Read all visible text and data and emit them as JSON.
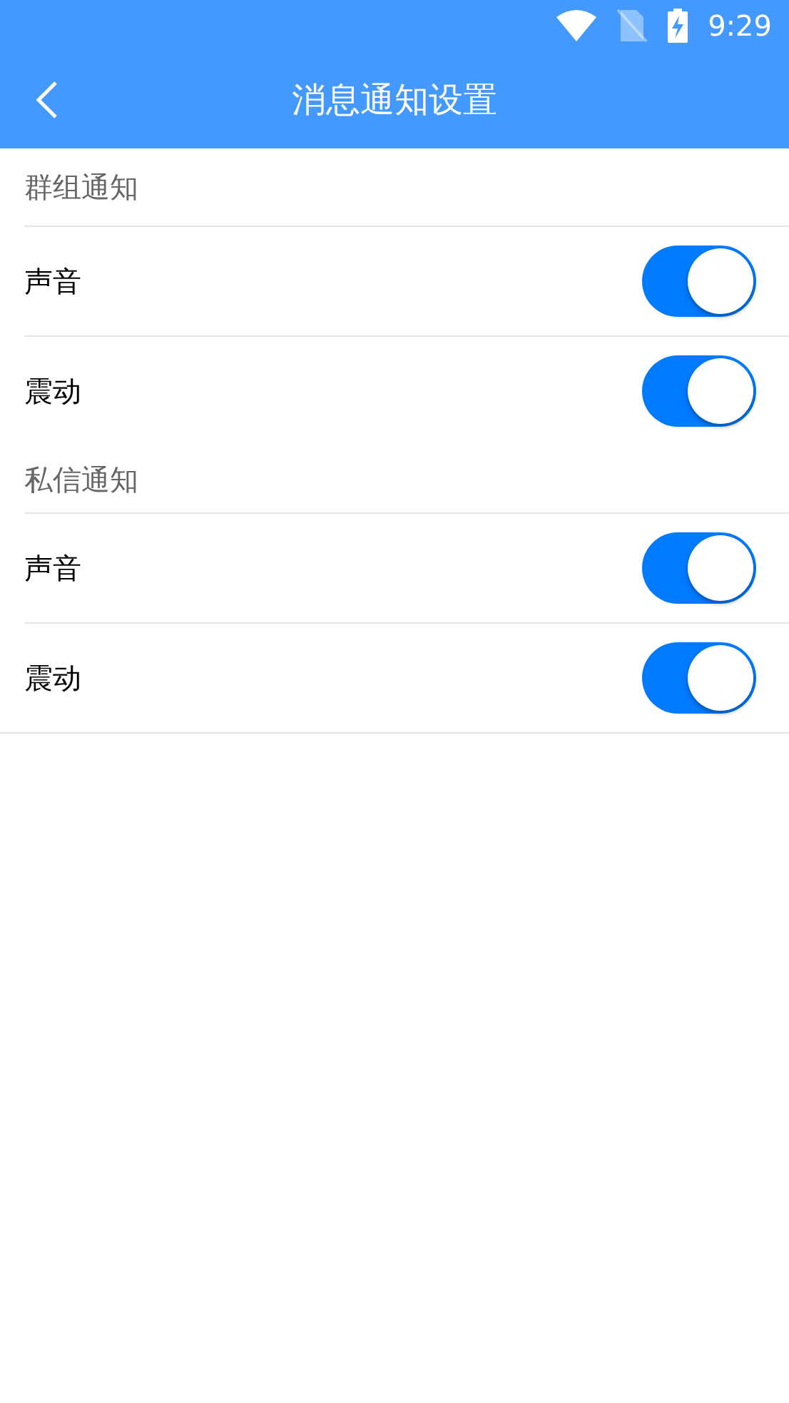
{
  "status_bar": {
    "time": "9:29"
  },
  "header": {
    "title": "消息通知设置"
  },
  "sections": [
    {
      "title": "群组通知",
      "items": [
        {
          "label": "声音",
          "on": true
        },
        {
          "label": "震动",
          "on": true
        }
      ]
    },
    {
      "title": "私信通知",
      "items": [
        {
          "label": "声音",
          "on": true
        },
        {
          "label": "震动",
          "on": true
        }
      ]
    }
  ]
}
